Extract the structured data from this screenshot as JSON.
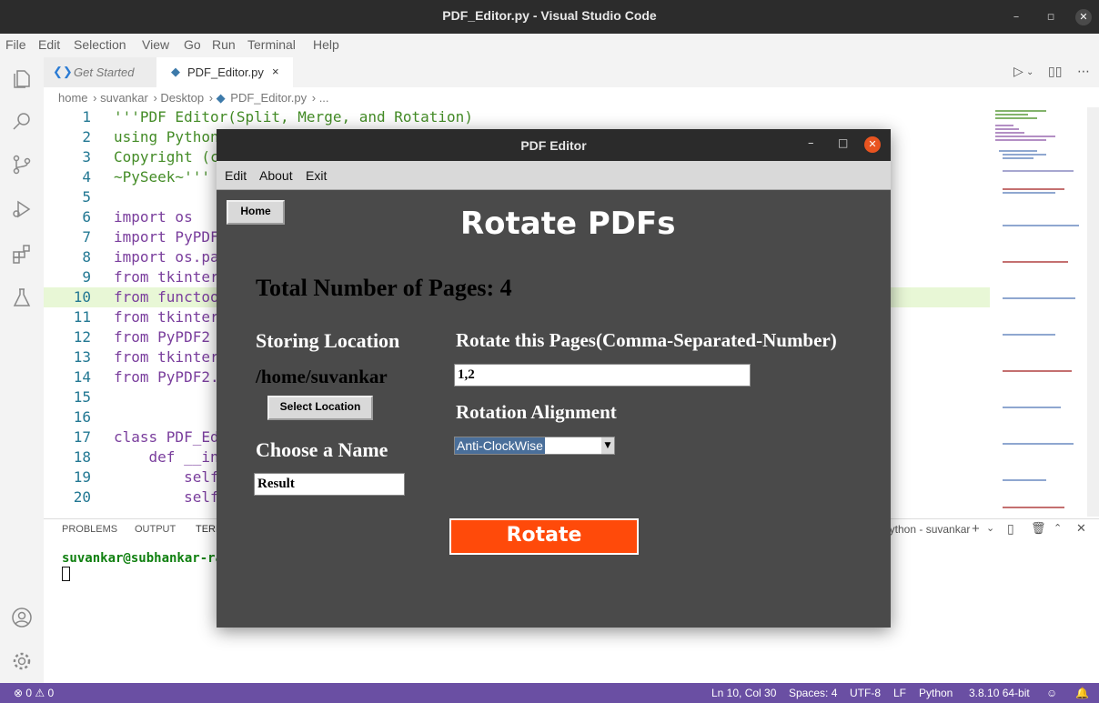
{
  "window": {
    "title": "PDF_Editor.py - Visual Studio Code"
  },
  "menu": [
    "File",
    "Edit",
    "Selection",
    "View",
    "Go",
    "Run",
    "Terminal",
    "Help"
  ],
  "tabs": [
    {
      "label": "Get Started"
    },
    {
      "label": "PDF_Editor.py",
      "close": "×"
    }
  ],
  "breadcrumb": [
    "home",
    "suvankar",
    "Desktop",
    "PDF_Editor.py",
    "..."
  ],
  "editor": {
    "active_line": 10,
    "lines": [
      {
        "n": "1",
        "text": "'''PDF Editor(Split, Merge, and Rotation)"
      },
      {
        "n": "2",
        "text": "using Python"
      },
      {
        "n": "3",
        "text": "Copyright (c"
      },
      {
        "n": "4",
        "text": "~PySeek~'''"
      },
      {
        "n": "5",
        "text": ""
      },
      {
        "n": "6",
        "text": "import os"
      },
      {
        "n": "7",
        "text": "import PyPDF"
      },
      {
        "n": "8",
        "text": "import os.pa"
      },
      {
        "n": "9",
        "text": "from tkinter"
      },
      {
        "n": "10",
        "text": "from functoo"
      },
      {
        "n": "11",
        "text": "from tkinter"
      },
      {
        "n": "12",
        "text": "from PyPDF2"
      },
      {
        "n": "13",
        "text": "from tkinter"
      },
      {
        "n": "14",
        "text": "from PyPDF2."
      },
      {
        "n": "15",
        "text": ""
      },
      {
        "n": "16",
        "text": ""
      },
      {
        "n": "17",
        "text": "class PDF_Edi"
      },
      {
        "n": "18",
        "text": "    def __in"
      },
      {
        "n": "19",
        "text": "        self"
      },
      {
        "n": "20",
        "text": "        self"
      }
    ]
  },
  "panel": {
    "tabs": [
      "PROBLEMS",
      "OUTPUT",
      "TERM"
    ],
    "terminal_name": "python - suvankar",
    "prompt": "suvankar@subhankar-ra"
  },
  "statusbar": {
    "problems": "0",
    "warnings": "0",
    "position": "Ln 10, Col 30",
    "spaces": "Spaces: 4",
    "encoding": "UTF-8",
    "eol": "LF",
    "language": "Python",
    "interpreter": "3.8.10 64-bit"
  },
  "tk": {
    "title": "PDF Editor",
    "menu": [
      "Edit",
      "About",
      "Exit"
    ],
    "home_button": "Home",
    "heading": "Rotate PDFs",
    "total_pages": "Total Number of Pages: 4",
    "storing_location_label": "Storing Location",
    "storing_location_value": "/home/suvankar",
    "select_location_button": "Select Location",
    "choose_name_label": "Choose a Name",
    "name_value": "Result",
    "rotate_pages_label": "Rotate this Pages(Comma-Separated-Number)",
    "pages_value": "1,2",
    "alignment_label": "Rotation Alignment",
    "alignment_value": "Anti-ClockWise",
    "rotate_button": "Rotate"
  },
  "colors": {
    "statusbar": "#6a4fa3",
    "rotate_button": "#ff4a0a",
    "tk_background": "#4a4a4a"
  }
}
